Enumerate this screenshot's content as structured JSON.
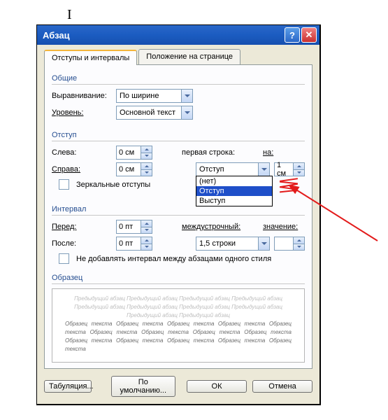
{
  "title": "Абзац",
  "tabs": {
    "active": "Отступы и интервалы",
    "other": "Положение на странице"
  },
  "sections": {
    "general": "Общие",
    "indent": "Отступ",
    "interval": "Интервал",
    "sample": "Образец"
  },
  "general": {
    "align_label": "Выравнивание:",
    "align_value": "По ширине",
    "level_label": "Уровень:",
    "level_value": "Основной текст"
  },
  "indent": {
    "left_label": "Слева:",
    "left_value": "0 см",
    "right_label": "Справа:",
    "right_value": "0 см",
    "mirror_label": "Зеркальные отступы",
    "firstline_label": "первая строка:",
    "firstline_value": "Отступ",
    "by_label": "на:",
    "by_value": "1 см",
    "dropdown": {
      "opt0": "(нет)",
      "opt1": "Отступ",
      "opt2": "Выступ"
    }
  },
  "interval": {
    "before_label": "Перед:",
    "before_value": "0 пт",
    "after_label": "После:",
    "after_value": "0 пт",
    "linespacing_label": "междустрочный:",
    "linespacing_value": "1,5 строки",
    "at_label": "значение:",
    "at_value": "",
    "noadd_label": "Не добавлять интервал между абзацами одного стиля"
  },
  "sample": {
    "light": "Предыдущий абзац Предыдущий абзац Предыдущий абзац Предыдущий абзац Предыдущий абзац Предыдущий абзац Предыдущий абзац Предыдущий абзац Предыдущий абзац Предыдущий абзац",
    "dark": "Образец текста Образец текста Образец текста Образец текста Образец текста Образец текста Образец текста Образец текста Образец текста Образец текста Образец текста Образец текста Образец текста Образец текста"
  },
  "buttons": {
    "tabs": "Табуляция...",
    "default": "По умолчанию...",
    "ok": "ОК",
    "cancel": "Отмена"
  }
}
